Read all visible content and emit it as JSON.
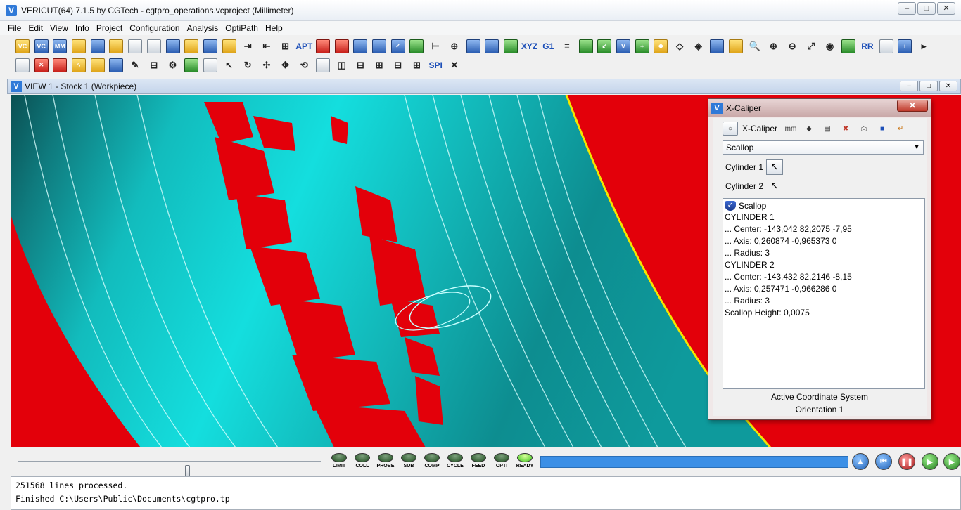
{
  "window": {
    "title": "VERICUT(64)  7.1.5 by CGTech - cgtpro_operations.vcproject (Millimeter)",
    "controls": [
      "minimize",
      "maximize",
      "close"
    ]
  },
  "menu": [
    "File",
    "Edit",
    "View",
    "Info",
    "Project",
    "Configuration",
    "Analysis",
    "OptiPath",
    "Help"
  ],
  "toolbar1": [
    {
      "icon": "open-project-icon",
      "color": "y",
      "glyph": "VC"
    },
    {
      "icon": "save-project-icon",
      "color": "b",
      "glyph": "VC"
    },
    {
      "icon": "save-as-icon",
      "color": "b",
      "glyph": "MM"
    },
    {
      "icon": "open-file-icon",
      "color": "y",
      "glyph": ""
    },
    {
      "icon": "save-file-icon",
      "color": "b",
      "glyph": ""
    },
    {
      "icon": "import-icon",
      "color": "y",
      "glyph": ""
    },
    {
      "icon": "document-icon",
      "color": "w",
      "glyph": ""
    },
    {
      "icon": "notes-icon",
      "color": "w",
      "glyph": ""
    },
    {
      "icon": "save-layout-icon",
      "color": "b",
      "glyph": ""
    },
    {
      "icon": "open-layout-icon",
      "color": "y",
      "glyph": ""
    },
    {
      "icon": "export-icon",
      "color": "b",
      "glyph": ""
    },
    {
      "icon": "tool-manager-icon",
      "color": "y",
      "glyph": ""
    },
    {
      "icon": "import-nc-icon",
      "color": "k",
      "glyph": "⇥"
    },
    {
      "icon": "run-to-icon",
      "color": "k",
      "glyph": "⇤"
    },
    {
      "icon": "nc-tree-icon",
      "color": "k",
      "glyph": "⊞"
    },
    {
      "icon": "apt-icon",
      "color": "t",
      "glyph": "APT"
    },
    {
      "icon": "report-icon",
      "color": "r",
      "glyph": ""
    },
    {
      "icon": "machine-icon",
      "color": "r",
      "glyph": ""
    },
    {
      "icon": "save-disk-icon",
      "color": "b",
      "glyph": ""
    },
    {
      "icon": "settings-icon",
      "color": "b",
      "glyph": ""
    },
    {
      "icon": "check-shield-icon",
      "color": "b",
      "glyph": "✓"
    },
    {
      "icon": "table-icon",
      "color": "g",
      "glyph": ""
    },
    {
      "icon": "g-code-icon",
      "color": "k",
      "glyph": "⊢"
    },
    {
      "icon": "target-icon",
      "color": "k",
      "glyph": "⊕"
    },
    {
      "icon": "save-model-icon",
      "color": "b",
      "glyph": ""
    },
    {
      "icon": "save-stock-icon",
      "color": "b",
      "glyph": ""
    },
    {
      "icon": "variables-icon",
      "color": "g",
      "glyph": ""
    },
    {
      "icon": "xyz-icon",
      "color": "t",
      "glyph": "XYZ"
    },
    {
      "icon": "g1-icon",
      "color": "t",
      "glyph": "G1"
    },
    {
      "icon": "list-icon",
      "color": "k",
      "glyph": "≡"
    },
    {
      "icon": "compare-icon",
      "color": "g",
      "glyph": ""
    },
    {
      "icon": "move-icon",
      "color": "g",
      "glyph": "↙"
    },
    {
      "icon": "vericut-icon",
      "color": "b",
      "glyph": "V"
    },
    {
      "icon": "add-tool-icon",
      "color": "g",
      "glyph": "+"
    },
    {
      "icon": "diamond-icon",
      "color": "y",
      "glyph": "◆"
    },
    {
      "icon": "measure-icon",
      "color": "k",
      "glyph": "◇"
    },
    {
      "icon": "section-icon",
      "color": "k",
      "glyph": "◈"
    },
    {
      "icon": "color-icon",
      "color": "b",
      "glyph": ""
    },
    {
      "icon": "palette-icon",
      "color": "y",
      "glyph": ""
    },
    {
      "icon": "zoom-icon",
      "color": "k",
      "glyph": "🔍"
    },
    {
      "icon": "zoom-in-icon",
      "color": "k",
      "glyph": "⊕"
    },
    {
      "icon": "zoom-out-icon",
      "color": "k",
      "glyph": "⊖"
    },
    {
      "icon": "fit-icon",
      "color": "k",
      "glyph": "⤢"
    },
    {
      "icon": "eye-icon",
      "color": "k",
      "glyph": "◉"
    },
    {
      "icon": "view-options-icon",
      "color": "g",
      "glyph": ""
    },
    {
      "icon": "rr-icon",
      "color": "t",
      "glyph": "RR"
    },
    {
      "icon": "home-icon",
      "color": "w",
      "glyph": ""
    },
    {
      "icon": "info-icon",
      "color": "b",
      "glyph": "i"
    },
    {
      "icon": "more-icon",
      "color": "k",
      "glyph": "▸"
    }
  ],
  "toolbar2": [
    {
      "icon": "reset-icon",
      "color": "w",
      "glyph": ""
    },
    {
      "icon": "clear-icon",
      "color": "r",
      "glyph": "✕"
    },
    {
      "icon": "tool-color-icon",
      "color": "r",
      "glyph": ""
    },
    {
      "icon": "lightning-icon",
      "color": "y",
      "glyph": "ϟ"
    },
    {
      "icon": "cube-icon",
      "color": "y",
      "glyph": ""
    },
    {
      "icon": "multi-cube-icon",
      "color": "b",
      "glyph": ""
    },
    {
      "icon": "tool-path-icon",
      "color": "k",
      "glyph": "✎"
    },
    {
      "icon": "machine-view-icon",
      "color": "k",
      "glyph": "⊟"
    },
    {
      "icon": "components-icon",
      "color": "k",
      "glyph": "⚙"
    },
    {
      "icon": "landscape-icon",
      "color": "g",
      "glyph": ""
    },
    {
      "icon": "printer-icon",
      "color": "w",
      "glyph": ""
    },
    {
      "icon": "axis-x-icon",
      "color": "k",
      "glyph": "↖"
    },
    {
      "icon": "rotate-icon",
      "color": "k",
      "glyph": "↻"
    },
    {
      "icon": "xy-icon",
      "color": "k",
      "glyph": "✢"
    },
    {
      "icon": "pan-icon",
      "color": "k",
      "glyph": "✥"
    },
    {
      "icon": "orbit-icon",
      "color": "k",
      "glyph": "⟲"
    },
    {
      "icon": "layout-single-icon",
      "color": "w",
      "glyph": ""
    },
    {
      "icon": "layout-vertical-icon",
      "color": "k",
      "glyph": "◫"
    },
    {
      "icon": "layout-horizontal-icon",
      "color": "k",
      "glyph": "⊟"
    },
    {
      "icon": "layout-three-icon",
      "color": "k",
      "glyph": "⊞"
    },
    {
      "icon": "layout-three-b-icon",
      "color": "k",
      "glyph": "⊟"
    },
    {
      "icon": "layout-four-icon",
      "color": "k",
      "glyph": "⊞"
    },
    {
      "icon": "spi-icon",
      "color": "t",
      "glyph": "SPI"
    },
    {
      "icon": "close-red-icon",
      "color": "k",
      "glyph": "✕"
    }
  ],
  "view": {
    "title": "VIEW 1 - Stock 1 (Workpiece)"
  },
  "caliper": {
    "title": "X-Caliper",
    "toolbar_label": "X-Caliper",
    "mode": "Scallop",
    "cylinder1_label": "Cylinder 1",
    "cylinder2_label": "Cylinder 2",
    "results_header": "Scallop",
    "results": [
      "CYLINDER 1",
      "... Center: -143,042 82,2075 -7,95",
      "... Axis: 0,260874 -0,965373 0",
      "... Radius: 3",
      "CYLINDER 2",
      "... Center: -143,432 82,2146 -8,15",
      "... Axis: 0,257471 -0,966286 0",
      "... Radius: 3",
      "Scallop Height: 0,0075"
    ],
    "footer1": "Active Coordinate System",
    "footer2": "Orientation 1"
  },
  "lamps": [
    {
      "label": "LIMIT",
      "on": false
    },
    {
      "label": "COLL",
      "on": false
    },
    {
      "label": "PROBE",
      "on": false
    },
    {
      "label": "SUB",
      "on": false
    },
    {
      "label": "COMP",
      "on": false
    },
    {
      "label": "CYCLE",
      "on": false
    },
    {
      "label": "FEED",
      "on": false
    },
    {
      "label": "OPTI",
      "on": false
    },
    {
      "label": "READY",
      "on": true
    }
  ],
  "playback": {
    "progress": 1.0,
    "slider_position": 0.49
  },
  "log": [
    "251568 lines processed.",
    "Finished C:\\Users\\Public\\Documents\\cgtpro.tp"
  ],
  "colors": {
    "stock_cut": "#18d8d8",
    "gouge": "#e3000a",
    "background": "#e3000a",
    "progress": "#3b8fe6"
  }
}
